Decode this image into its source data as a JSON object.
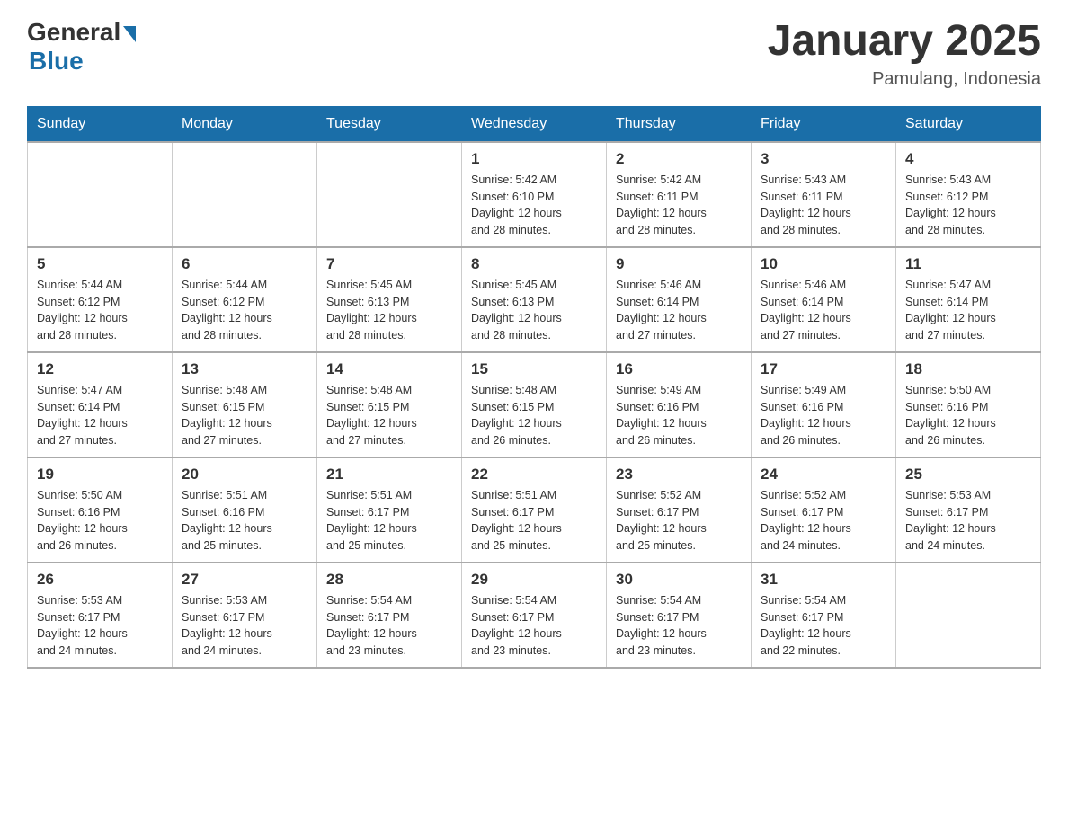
{
  "header": {
    "logo_general": "General",
    "logo_blue": "Blue",
    "title": "January 2025",
    "subtitle": "Pamulang, Indonesia"
  },
  "days_of_week": [
    "Sunday",
    "Monday",
    "Tuesday",
    "Wednesday",
    "Thursday",
    "Friday",
    "Saturday"
  ],
  "weeks": [
    [
      {
        "day": "",
        "info": ""
      },
      {
        "day": "",
        "info": ""
      },
      {
        "day": "",
        "info": ""
      },
      {
        "day": "1",
        "info": "Sunrise: 5:42 AM\nSunset: 6:10 PM\nDaylight: 12 hours\nand 28 minutes."
      },
      {
        "day": "2",
        "info": "Sunrise: 5:42 AM\nSunset: 6:11 PM\nDaylight: 12 hours\nand 28 minutes."
      },
      {
        "day": "3",
        "info": "Sunrise: 5:43 AM\nSunset: 6:11 PM\nDaylight: 12 hours\nand 28 minutes."
      },
      {
        "day": "4",
        "info": "Sunrise: 5:43 AM\nSunset: 6:12 PM\nDaylight: 12 hours\nand 28 minutes."
      }
    ],
    [
      {
        "day": "5",
        "info": "Sunrise: 5:44 AM\nSunset: 6:12 PM\nDaylight: 12 hours\nand 28 minutes."
      },
      {
        "day": "6",
        "info": "Sunrise: 5:44 AM\nSunset: 6:12 PM\nDaylight: 12 hours\nand 28 minutes."
      },
      {
        "day": "7",
        "info": "Sunrise: 5:45 AM\nSunset: 6:13 PM\nDaylight: 12 hours\nand 28 minutes."
      },
      {
        "day": "8",
        "info": "Sunrise: 5:45 AM\nSunset: 6:13 PM\nDaylight: 12 hours\nand 28 minutes."
      },
      {
        "day": "9",
        "info": "Sunrise: 5:46 AM\nSunset: 6:14 PM\nDaylight: 12 hours\nand 27 minutes."
      },
      {
        "day": "10",
        "info": "Sunrise: 5:46 AM\nSunset: 6:14 PM\nDaylight: 12 hours\nand 27 minutes."
      },
      {
        "day": "11",
        "info": "Sunrise: 5:47 AM\nSunset: 6:14 PM\nDaylight: 12 hours\nand 27 minutes."
      }
    ],
    [
      {
        "day": "12",
        "info": "Sunrise: 5:47 AM\nSunset: 6:14 PM\nDaylight: 12 hours\nand 27 minutes."
      },
      {
        "day": "13",
        "info": "Sunrise: 5:48 AM\nSunset: 6:15 PM\nDaylight: 12 hours\nand 27 minutes."
      },
      {
        "day": "14",
        "info": "Sunrise: 5:48 AM\nSunset: 6:15 PM\nDaylight: 12 hours\nand 27 minutes."
      },
      {
        "day": "15",
        "info": "Sunrise: 5:48 AM\nSunset: 6:15 PM\nDaylight: 12 hours\nand 26 minutes."
      },
      {
        "day": "16",
        "info": "Sunrise: 5:49 AM\nSunset: 6:16 PM\nDaylight: 12 hours\nand 26 minutes."
      },
      {
        "day": "17",
        "info": "Sunrise: 5:49 AM\nSunset: 6:16 PM\nDaylight: 12 hours\nand 26 minutes."
      },
      {
        "day": "18",
        "info": "Sunrise: 5:50 AM\nSunset: 6:16 PM\nDaylight: 12 hours\nand 26 minutes."
      }
    ],
    [
      {
        "day": "19",
        "info": "Sunrise: 5:50 AM\nSunset: 6:16 PM\nDaylight: 12 hours\nand 26 minutes."
      },
      {
        "day": "20",
        "info": "Sunrise: 5:51 AM\nSunset: 6:16 PM\nDaylight: 12 hours\nand 25 minutes."
      },
      {
        "day": "21",
        "info": "Sunrise: 5:51 AM\nSunset: 6:17 PM\nDaylight: 12 hours\nand 25 minutes."
      },
      {
        "day": "22",
        "info": "Sunrise: 5:51 AM\nSunset: 6:17 PM\nDaylight: 12 hours\nand 25 minutes."
      },
      {
        "day": "23",
        "info": "Sunrise: 5:52 AM\nSunset: 6:17 PM\nDaylight: 12 hours\nand 25 minutes."
      },
      {
        "day": "24",
        "info": "Sunrise: 5:52 AM\nSunset: 6:17 PM\nDaylight: 12 hours\nand 24 minutes."
      },
      {
        "day": "25",
        "info": "Sunrise: 5:53 AM\nSunset: 6:17 PM\nDaylight: 12 hours\nand 24 minutes."
      }
    ],
    [
      {
        "day": "26",
        "info": "Sunrise: 5:53 AM\nSunset: 6:17 PM\nDaylight: 12 hours\nand 24 minutes."
      },
      {
        "day": "27",
        "info": "Sunrise: 5:53 AM\nSunset: 6:17 PM\nDaylight: 12 hours\nand 24 minutes."
      },
      {
        "day": "28",
        "info": "Sunrise: 5:54 AM\nSunset: 6:17 PM\nDaylight: 12 hours\nand 23 minutes."
      },
      {
        "day": "29",
        "info": "Sunrise: 5:54 AM\nSunset: 6:17 PM\nDaylight: 12 hours\nand 23 minutes."
      },
      {
        "day": "30",
        "info": "Sunrise: 5:54 AM\nSunset: 6:17 PM\nDaylight: 12 hours\nand 23 minutes."
      },
      {
        "day": "31",
        "info": "Sunrise: 5:54 AM\nSunset: 6:17 PM\nDaylight: 12 hours\nand 22 minutes."
      },
      {
        "day": "",
        "info": ""
      }
    ]
  ]
}
